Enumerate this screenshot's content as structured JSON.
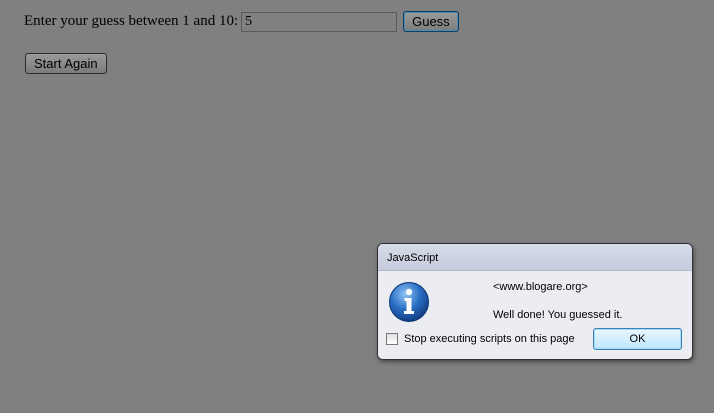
{
  "page": {
    "guess_prompt": "Enter your guess between 1 and 10:",
    "guess_value": "5",
    "guess_button": "Guess",
    "start_again_button": "Start Again"
  },
  "dialog": {
    "title": "JavaScript",
    "origin": "<www.blogare.org>",
    "message": "Well done! You guessed it.",
    "stop_scripts_label": "Stop executing scripts on this page",
    "stop_scripts_checked": false,
    "ok_button": "OK",
    "icon": "info-icon"
  },
  "colors": {
    "page_background": "#808080",
    "dialog_background": "#ececf2",
    "info_icon_blue": "#1f5fb0"
  }
}
